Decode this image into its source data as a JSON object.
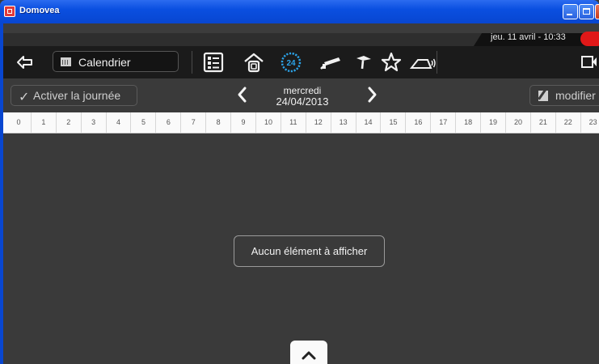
{
  "window": {
    "title": "Domovea",
    "colors": {
      "titlebar": "#0a4fe0",
      "background": "#3a3a3a",
      "accent_red": "#e01818"
    }
  },
  "status": {
    "datetime": "jeu. 11 avril - 10:33"
  },
  "toolbar": {
    "back_icon": "back-arrow-icon",
    "view_label": "Calendrier",
    "icons": [
      "list-panel-icon",
      "home-icon",
      "clock-24-icon",
      "camera-icon",
      "pointer-icon",
      "star-icon",
      "home-alarm-icon",
      "exit-icon"
    ]
  },
  "nav": {
    "activate_label": "Activer la journée",
    "day_name": "mercredi",
    "date": "24/04/2013",
    "edit_label": "modifier"
  },
  "hours": [
    "0",
    "1",
    "2",
    "3",
    "4",
    "5",
    "6",
    "7",
    "8",
    "9",
    "10",
    "11",
    "12",
    "13",
    "14",
    "15",
    "16",
    "17",
    "18",
    "19",
    "20",
    "21",
    "22",
    "23"
  ],
  "main": {
    "empty_message": "Aucun élément à afficher"
  }
}
